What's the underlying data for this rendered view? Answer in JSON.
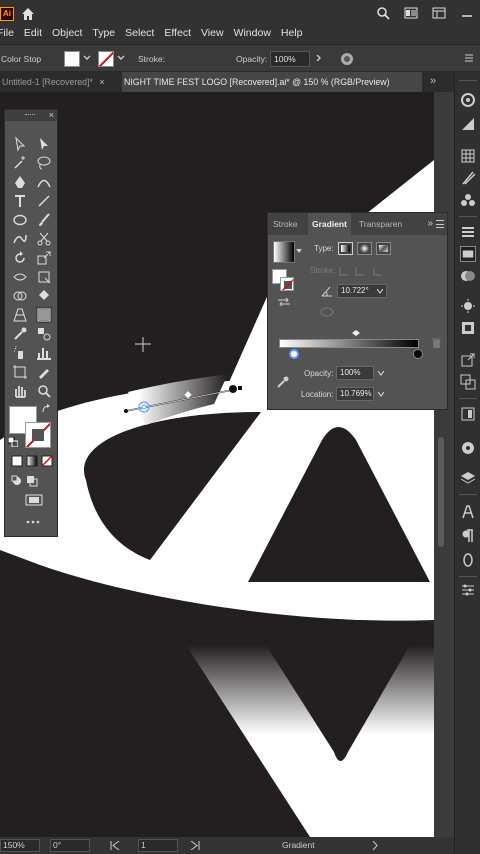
{
  "app": {
    "logo_text": "Ai",
    "menu": [
      "File",
      "Edit",
      "Object",
      "Type",
      "Select",
      "Effect",
      "View",
      "Window",
      "Help"
    ]
  },
  "control_bar": {
    "selection_label": "Color Stop",
    "stroke_label": "Stroke:",
    "opacity_label": "Opacity:",
    "opacity_value": "100%"
  },
  "tabs": {
    "inactive_title": "Untitled-1 [Recovered]*",
    "active_title": "NIGHT TIME FEST LOGO [Recovered].ai* @ 150 % (RGB/Preview)",
    "more": "»"
  },
  "gradient_panel": {
    "tabs": [
      "Stroke",
      "Gradient",
      "Transparen"
    ],
    "type_label": "Type:",
    "stroke_label": "Stroke:",
    "angle_value": "10.722°",
    "opacity_label": "Opacity:",
    "opacity_value": "100%",
    "location_label": "Location:",
    "location_value": "10.769%",
    "stops": [
      {
        "color": "#ffffff",
        "location_pct": 10.769
      },
      {
        "color": "#000000",
        "location_pct": 100
      }
    ],
    "midpoint_pct": 55
  },
  "status_bar": {
    "zoom": "150%",
    "rotation": "0°",
    "artboard": "1",
    "tool_name": "Gradient"
  },
  "colors": {
    "canvas": "#231f20",
    "ui_dark": "#323232",
    "panel": "#535353",
    "accent_red": "#d01010"
  }
}
